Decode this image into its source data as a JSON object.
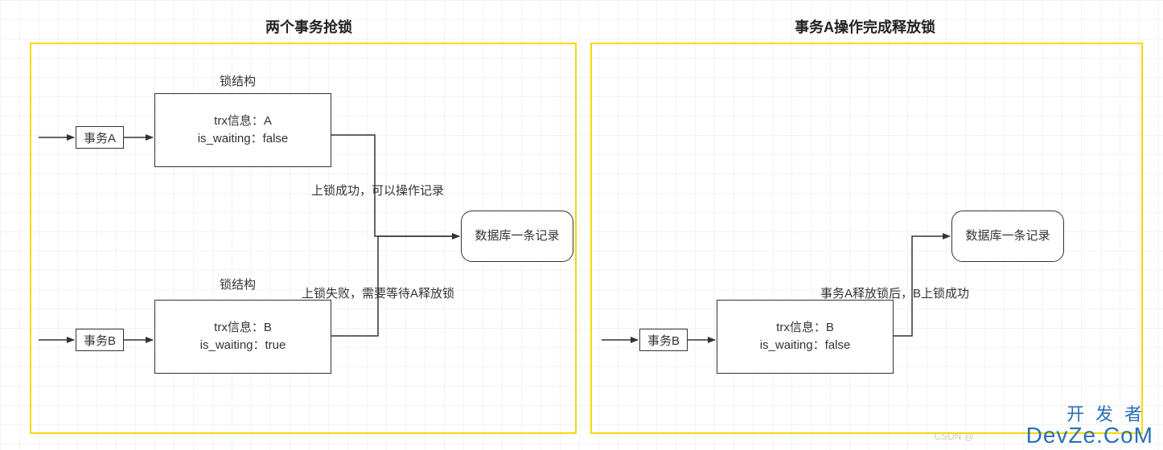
{
  "diagram": {
    "left": {
      "title": "两个事务抢锁",
      "lockStructLabelA": "锁结构",
      "lockStructLabelB": "锁结构",
      "txA": {
        "label": "事务A"
      },
      "txB": {
        "label": "事务B"
      },
      "lockA": {
        "line1": "trx信息：A",
        "line2": "is_waiting：false"
      },
      "lockB": {
        "line1": "trx信息：B",
        "line2": "is_waiting：true"
      },
      "edgeA": "上锁成功，可以操作记录",
      "edgeB": "上锁失败，需要等待A释放锁",
      "record": "数据库一条记录"
    },
    "right": {
      "title": "事务A操作完成释放锁",
      "txB": {
        "label": "事务B"
      },
      "lockB": {
        "line1": "trx信息：B",
        "line2": "is_waiting：false"
      },
      "edge": "事务A释放锁后，B上锁成功",
      "record": "数据库一条记录"
    }
  },
  "watermark": {
    "top": "开发者",
    "bottom": "DevZe.CoM",
    "csdn": "CSDN @"
  }
}
